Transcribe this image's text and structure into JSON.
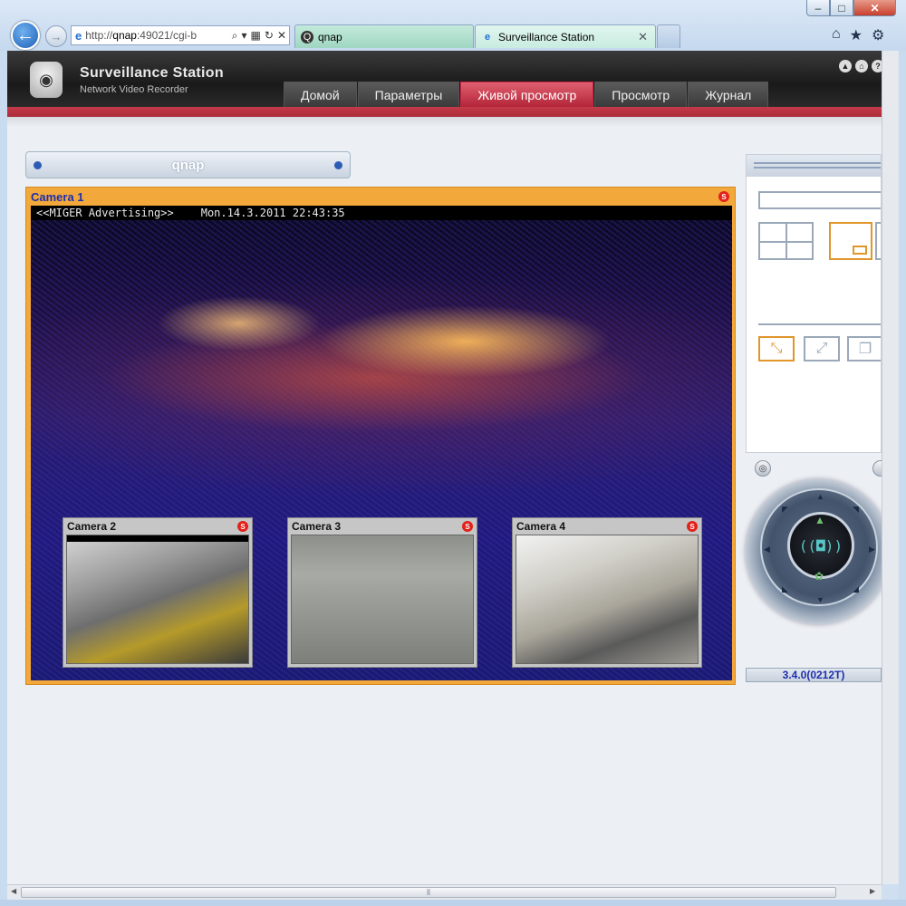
{
  "browser": {
    "address_scheme": "http://",
    "address_host": "qnap",
    "address_rest": ":49021/cgi-b",
    "tabs": [
      {
        "label": "qnap"
      },
      {
        "label": "Surveillance Station"
      }
    ]
  },
  "app": {
    "title": "Surveillance Station",
    "subtitle": "Network Video Recorder",
    "nav": [
      {
        "label": "Домой"
      },
      {
        "label": "Параметры"
      },
      {
        "label": "Живой просмотр"
      },
      {
        "label": "Просмотр"
      },
      {
        "label": "Журнал"
      }
    ],
    "active_nav": "Живой просмотр",
    "accent_color": "#c53a48"
  },
  "server": {
    "name": "qnap"
  },
  "main_camera": {
    "label": "Camera 1",
    "osd_text": "<<MIGER Advertising>>",
    "osd_time": "Mon.14.3.2011  22:43:35",
    "rec_badge": "S"
  },
  "thumbnails": [
    {
      "label": "Camera 2",
      "rec_badge": "S"
    },
    {
      "label": "Camera 3",
      "rec_badge": "S"
    },
    {
      "label": "Camera 4",
      "rec_badge": "S"
    }
  ],
  "version": "3.4.0(0212T)"
}
